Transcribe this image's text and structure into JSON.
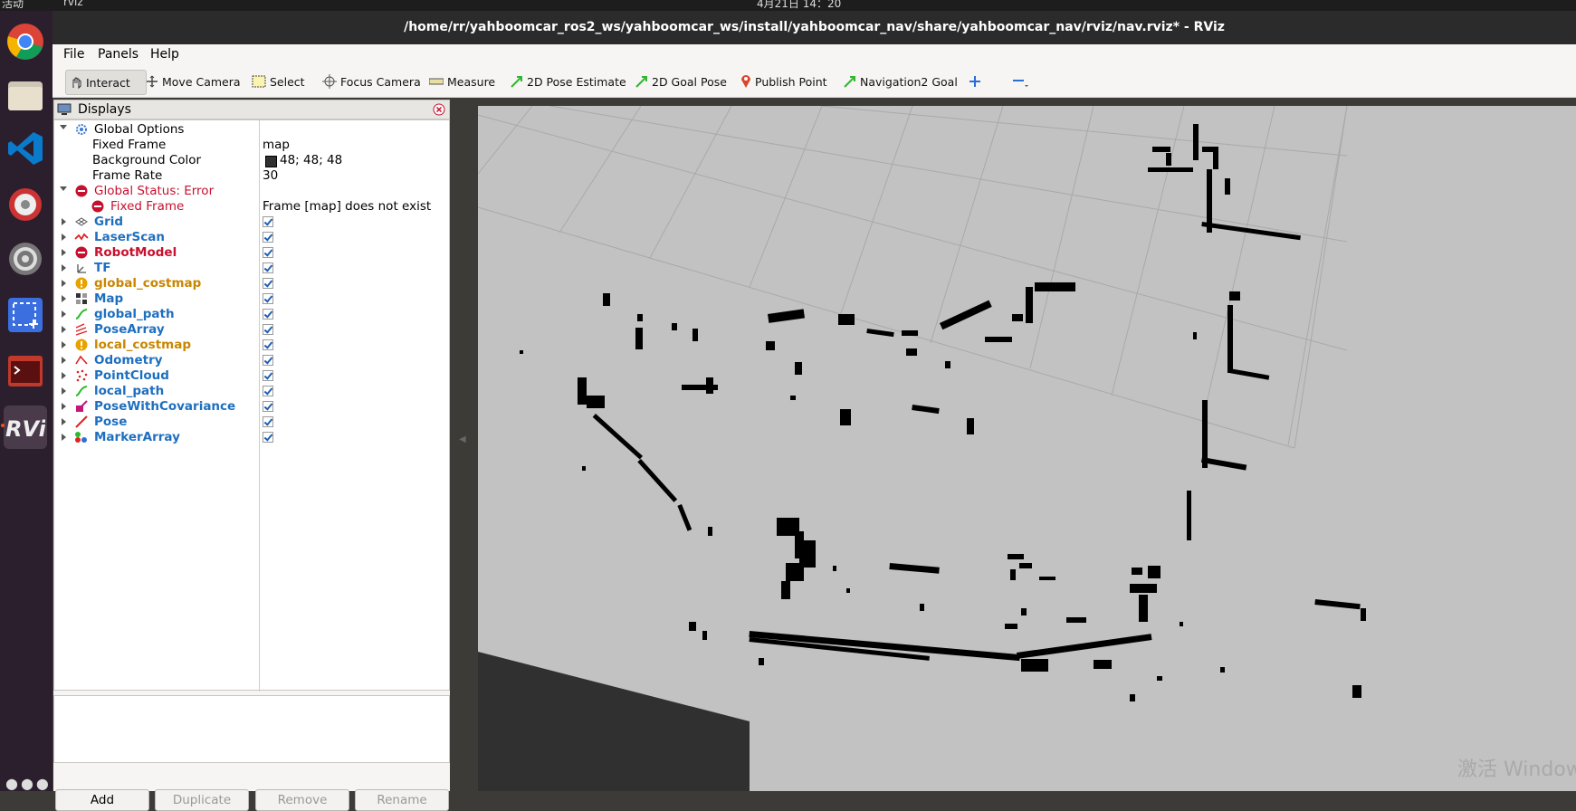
{
  "topbar": {
    "activities": "活动",
    "app_menu": "rviz",
    "clock": "4月21日 14：20"
  },
  "window": {
    "title": "/home/rr/yahboomcar_ros2_ws/yahboomcar_ws/install/yahboomcar_nav/share/yahboomcar_nav/rviz/nav.rviz* - RViz"
  },
  "menu": {
    "file": "File",
    "panels": "Panels",
    "help": "Help"
  },
  "toolbar": {
    "interact": "Interact",
    "move_camera": "Move Camera",
    "select": "Select",
    "focus_camera": "Focus Camera",
    "measure": "Measure",
    "pose_estimate": "2D Pose Estimate",
    "goal_pose": "2D Goal Pose",
    "publish_point": "Publish Point",
    "nav2_goal": "Navigation2 Goal"
  },
  "displays": {
    "title": "Displays",
    "global_options": {
      "label": "Global Options",
      "fixed_frame_label": "Fixed Frame",
      "fixed_frame_value": "map",
      "background_color_label": "Background Color",
      "background_color_value": "48; 48; 48",
      "background_color_hex": "#303030",
      "frame_rate_label": "Frame Rate",
      "frame_rate_value": "30"
    },
    "global_status": {
      "label": "Global Status: Error",
      "fixed_frame_label": "Fixed Frame",
      "fixed_frame_value": "Frame [map] does not exist"
    },
    "items": [
      {
        "label": "Grid",
        "status": "ok",
        "checked": true,
        "icon": "grid-icon"
      },
      {
        "label": "LaserScan",
        "status": "ok",
        "checked": true,
        "icon": "laserscan-icon"
      },
      {
        "label": "RobotModel",
        "status": "error",
        "checked": true,
        "icon": "error-icon"
      },
      {
        "label": "TF",
        "status": "ok",
        "checked": true,
        "icon": "tf-icon"
      },
      {
        "label": "global_costmap",
        "status": "warn",
        "checked": true,
        "icon": "warning-icon"
      },
      {
        "label": "Map",
        "status": "ok",
        "checked": true,
        "icon": "map-icon"
      },
      {
        "label": "global_path",
        "status": "ok",
        "checked": true,
        "icon": "path-icon"
      },
      {
        "label": "PoseArray",
        "status": "ok",
        "checked": true,
        "icon": "posearray-icon"
      },
      {
        "label": "local_costmap",
        "status": "warn",
        "checked": true,
        "icon": "warning-icon"
      },
      {
        "label": "Odometry",
        "status": "ok",
        "checked": true,
        "icon": "odometry-icon"
      },
      {
        "label": "PointCloud",
        "status": "ok",
        "checked": true,
        "icon": "pointcloud-icon"
      },
      {
        "label": "local_path",
        "status": "ok",
        "checked": true,
        "icon": "path-icon"
      },
      {
        "label": "PoseWithCovariance",
        "status": "ok",
        "checked": true,
        "icon": "posecov-icon"
      },
      {
        "label": "Pose",
        "status": "ok",
        "checked": true,
        "icon": "pose-icon"
      },
      {
        "label": "MarkerArray",
        "status": "ok",
        "checked": true,
        "icon": "markerarray-icon"
      }
    ],
    "buttons": {
      "add": "Add",
      "duplicate": "Duplicate",
      "remove": "Remove",
      "rename": "Rename"
    }
  },
  "viewport": {
    "watermark": "激活 Windows"
  },
  "colors": {
    "status_error": "#c8102e",
    "status_warn": "#c98600",
    "status_ok": "#1e6fc0",
    "map_free": "#c2c2c2",
    "map_obstacle": "#000000"
  }
}
